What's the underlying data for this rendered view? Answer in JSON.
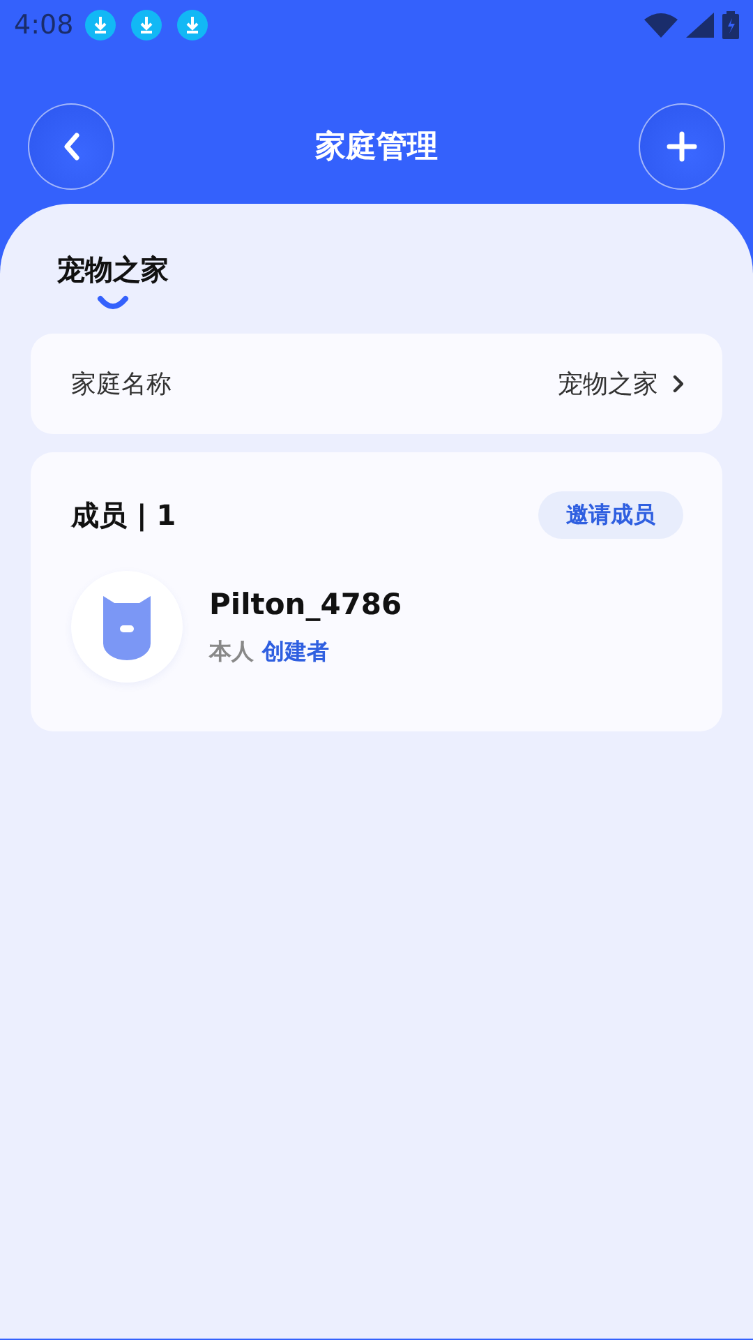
{
  "status_bar": {
    "time": "4:08",
    "notifications": [
      {
        "kind": "download"
      },
      {
        "kind": "download"
      },
      {
        "kind": "download"
      }
    ]
  },
  "header": {
    "title": "家庭管理"
  },
  "tabs": [
    {
      "label": "宠物之家",
      "selected": true
    }
  ],
  "family_name": {
    "label": "家庭名称",
    "value": "宠物之家"
  },
  "members": {
    "title": "成员 | 1",
    "invite_button": "邀请成员",
    "list": [
      {
        "name": "Pilton_4786",
        "self_label": "本人",
        "role": "创建者"
      }
    ]
  }
}
